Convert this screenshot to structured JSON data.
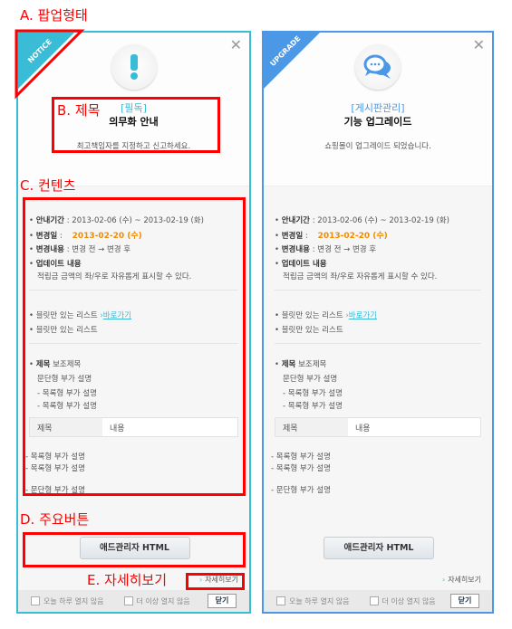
{
  "annotations": {
    "a": "A. 팝업형태",
    "b": "B. 제목",
    "c": "C. 컨텐츠",
    "d": "D. 주요버튼",
    "e": "E. 자세히보기"
  },
  "colors": {
    "notice": "#3bbcd6",
    "upgrade": "#4a98e6",
    "highlight": "#f28c00",
    "annotation": "#ff0000"
  },
  "popups": [
    {
      "ribbon": "NOTICE",
      "icon": "exclamation-icon",
      "category": "[필독]",
      "title": "의무화 안내",
      "desc": "최고책임자를 지정하고 신고하세요."
    },
    {
      "ribbon": "UPGRADE",
      "icon": "chat-bubbles-icon",
      "category": "[게시판관리]",
      "title": "기능 업그레이드",
      "desc": "쇼핑몰이 업그레이드 되었습니다."
    }
  ],
  "content": {
    "period_label": "안내기간",
    "period_value": "2013-02-06 (수) ~ 2013-02-19 (화)",
    "change_date_label": "변경일",
    "change_date_value": "2013-02-20 (수)",
    "change_label": "변경내용",
    "change_value": "변경 전 → 변경 후",
    "update_label": "업데이트 내용",
    "update_value": "적립금 금액의 좌/우로 자유롭게 표시할 수 있다.",
    "bullet_list_1": "블릿만 있는 리스트",
    "shortcut_link": "바로가기",
    "bullet_list_2": "블릿만 있는 리스트",
    "subject": "제목",
    "subtitle": "보조제목",
    "paragraph_desc": "문단형 부가 설명",
    "list_desc_1": "- 목록형 부가 설명",
    "list_desc_2": "- 목록형 부가 설명",
    "table_header": "제목",
    "table_cell": "내용",
    "list_desc_3": "- 목록형 부가 설명",
    "list_desc_4": "- 목록형 부가 설명",
    "paragraph_desc_2": "- 문단형 부가 설명"
  },
  "primary_button": "애드관리자 HTML",
  "detail_link": "자세히보기",
  "footer": {
    "today": "오늘 하루 열지 않음",
    "never": "더 이상 열지 않음",
    "close": "닫기"
  }
}
